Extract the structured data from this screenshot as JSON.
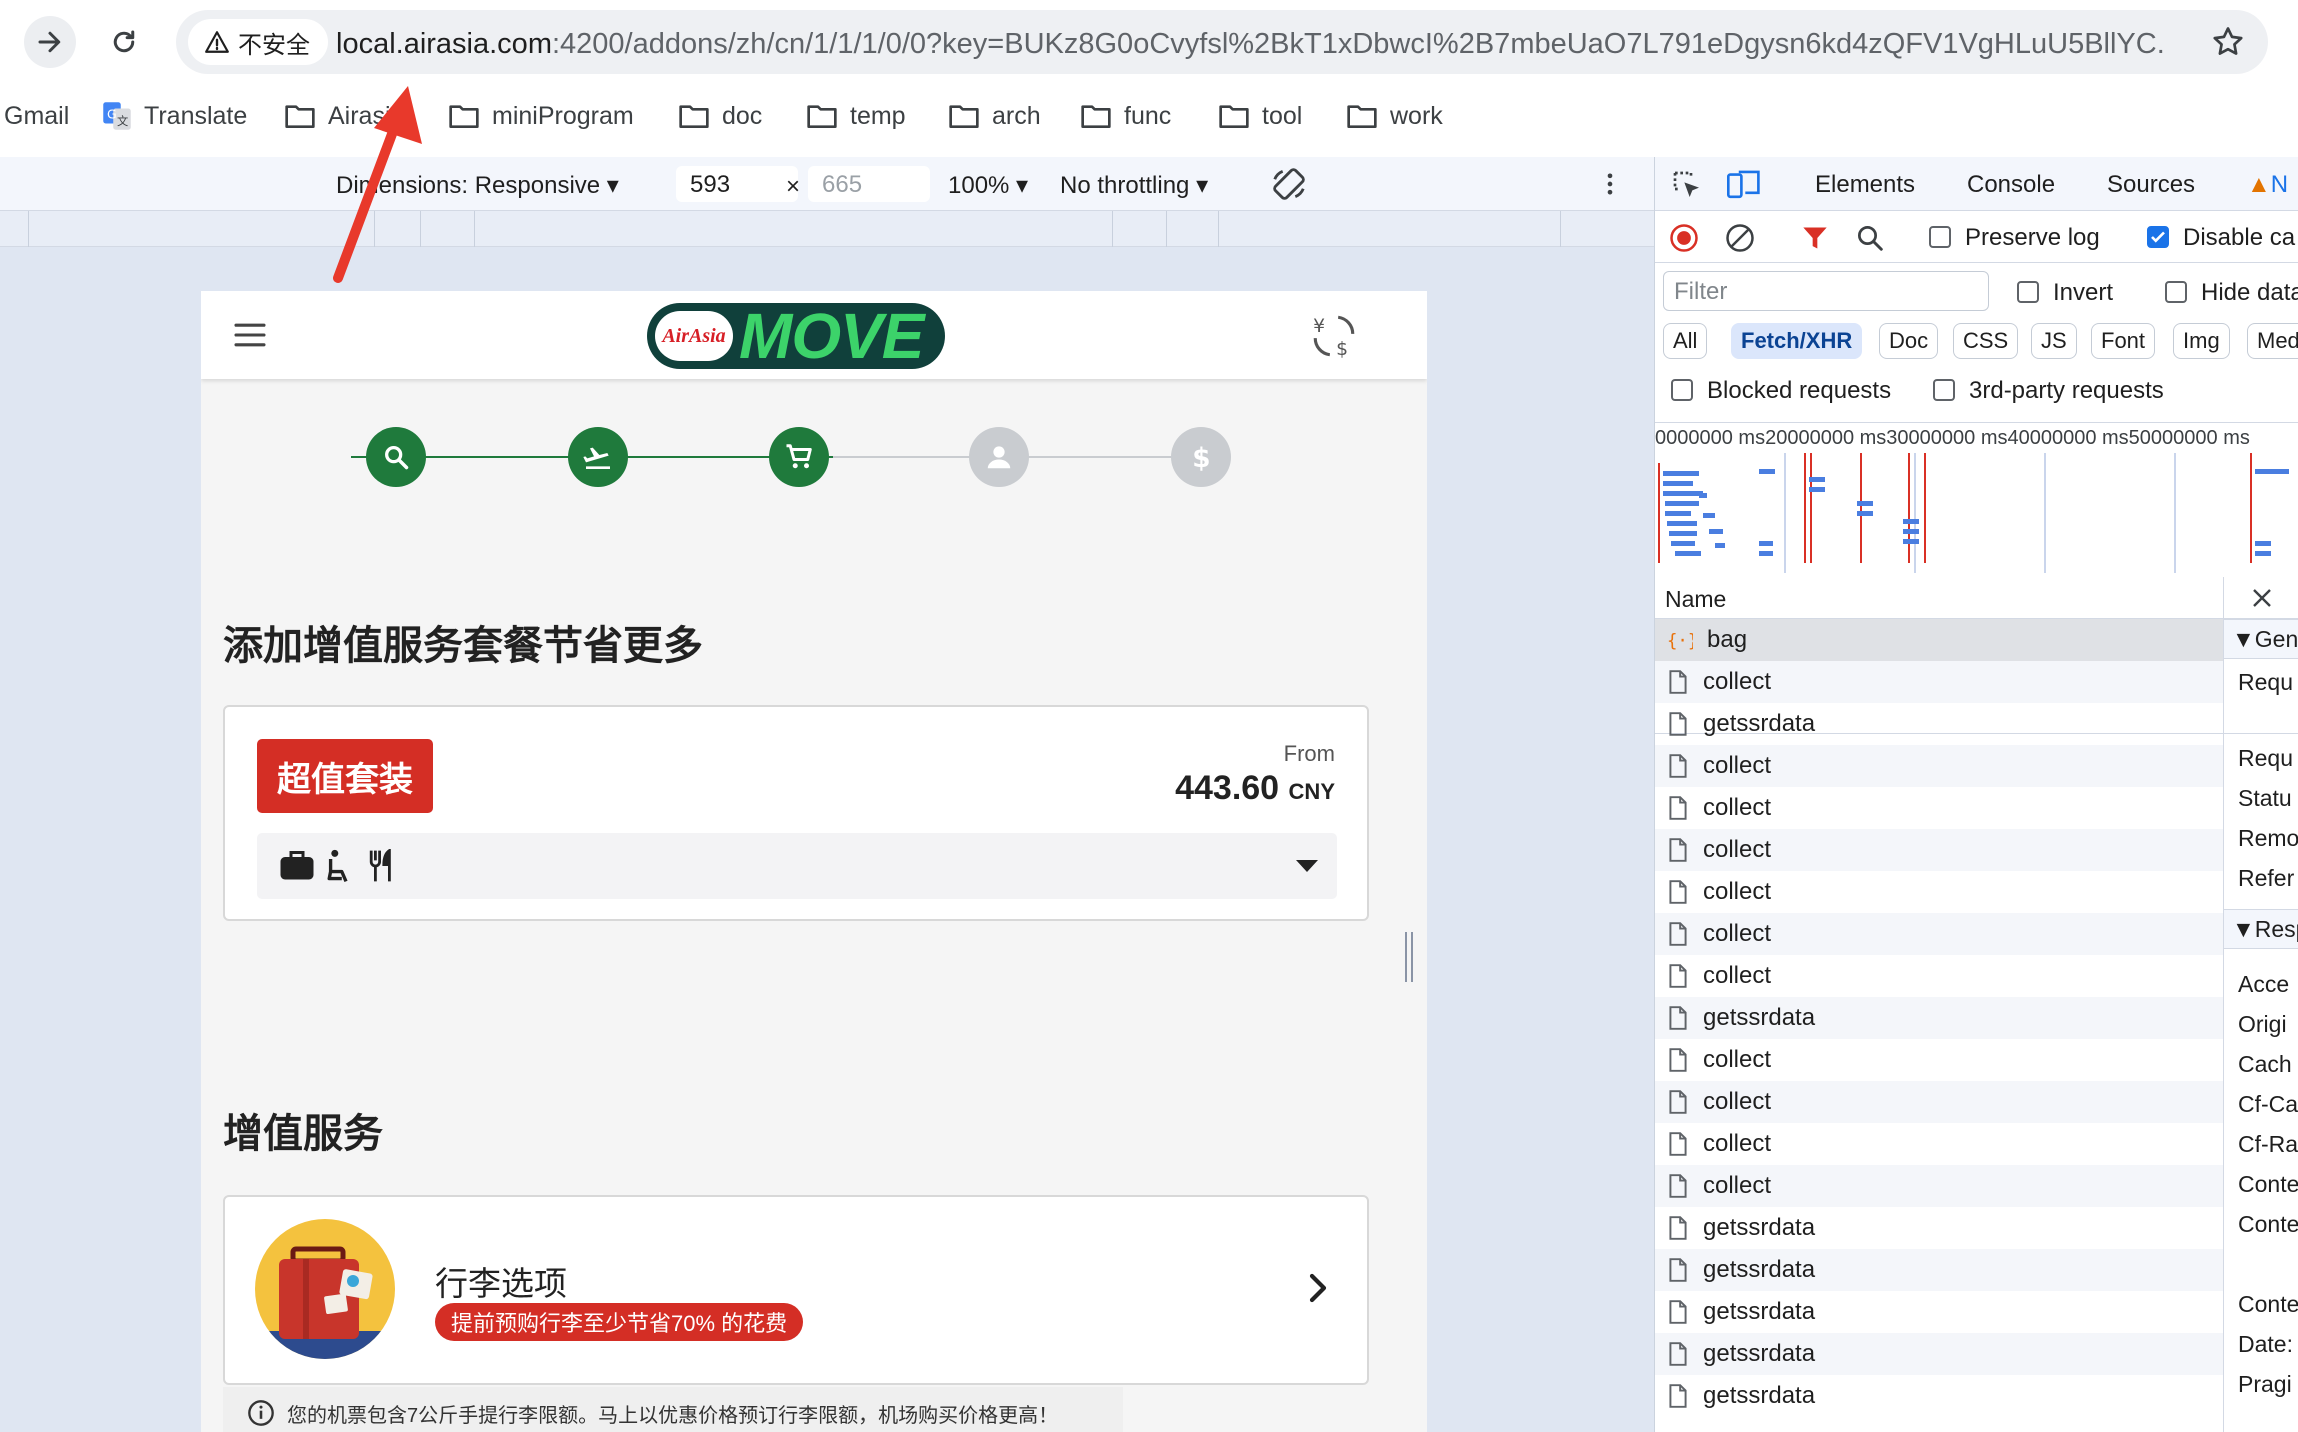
{
  "browser": {
    "security_label": "不安全",
    "url_host": "local.airasia.com",
    "url_rest": ":4200/addons/zh/cn/1/1/1/0/0?key=BUKz8G0oCvyfsl%2BkT1xDbwcI%2B7mbeUaO7L791eDgysn6kd4zQFV1VgHLuU5BllYC...",
    "bookmarks": [
      "Gmail",
      "Translate",
      "Airasia",
      "miniProgram",
      "doc",
      "temp",
      "arch",
      "func",
      "tool",
      "work"
    ]
  },
  "device_toolbar": {
    "dimensions_label": "Dimensions: Responsive",
    "width": "593",
    "height_placeholder": "665",
    "times": "×",
    "zoom": "100%",
    "throttling": "No throttling"
  },
  "app": {
    "logo_small": "AirAsia",
    "logo_big": "MOVE",
    "page_title": "添加增值服务套餐节省更多",
    "bundle": {
      "badge": "超值套装",
      "from_label": "From",
      "price": "443.60",
      "currency": "CNY"
    },
    "addons_title": "增值服务",
    "baggage": {
      "title": "行李选项",
      "tag": "提前预购行李至少节省70% 的花费",
      "note": "您的机票包含7公斤手提行李限额。马上以优惠价格预订行李限额，机场购买价格更高！"
    },
    "colors": {
      "brand_green": "#1f7a3c",
      "brand_red": "#d42e25",
      "logo_bg": "#10403b"
    }
  },
  "devtools": {
    "tabs": [
      "Elements",
      "Console",
      "Sources",
      "N"
    ],
    "preserve_log": "Preserve log",
    "disable_cache": "Disable ca",
    "filter_placeholder": "Filter",
    "invert": "Invert",
    "hide_data": "Hide data",
    "type_chips": [
      "All",
      "Fetch/XHR",
      "Doc",
      "CSS",
      "JS",
      "Font",
      "Img",
      "Med"
    ],
    "blocked_requests": "Blocked requests",
    "third_party": "3rd-party requests",
    "timeline_ticks": "0000000 ms20000000 ms30000000 ms40000000 ms50000000 ms",
    "name_header": "Name",
    "requests": [
      "bag",
      "collect",
      "getssrdata",
      "collect",
      "collect",
      "collect",
      "collect",
      "collect",
      "collect",
      "getssrdata",
      "collect",
      "collect",
      "collect",
      "collect",
      "getssrdata",
      "getssrdata",
      "getssrdata",
      "getssrdata",
      "getssrdata"
    ],
    "detail": {
      "general_header": "▼Gen",
      "general_rows": [
        "Requ",
        "Requ",
        "Statu",
        "Remo",
        "Refer"
      ],
      "response_header": "▼Resp",
      "response_rows": [
        "Acce",
        "Origi",
        "Cach",
        "Cf-Ca",
        "Cf-Ra",
        "Conte",
        "Conte",
        "Conte",
        "Date:",
        "Pragi"
      ]
    }
  }
}
